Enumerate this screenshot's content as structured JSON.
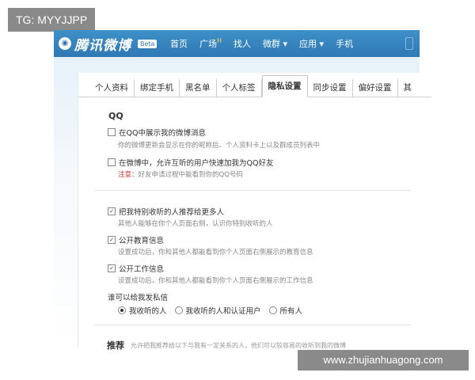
{
  "overlay_tag": "TG: MYYJJPP",
  "watermark": "www.zhujianhuagong.com",
  "header": {
    "logo_text": "腾讯微博",
    "beta": "Beta",
    "nav": [
      "首页",
      "广场",
      "找人",
      "微群 ▾",
      "应用 ▾",
      "手机"
    ],
    "hot_badge": "H"
  },
  "tabs": [
    "个人资料",
    "绑定手机",
    "黑名单",
    "个人标签",
    "隐私设置",
    "同步设置",
    "偏好设置",
    "其"
  ],
  "active_tab": "隐私设置",
  "qq_section": {
    "title": "QQ",
    "opt1_label": "在QQ中展示我的微博消息",
    "opt1_desc": "你的微博更新会显示在你的昵称后、个人资料卡上以及群成员列表中",
    "opt2_label": "在微博中，允许互听的用户快速加我为QQ好友",
    "opt2_note_label": "注意：",
    "opt2_note_text": "好友申请过程中能看到你的QQ号码"
  },
  "privacy_section": {
    "opt3_label": "把我特别收听的人推荐给更多人",
    "opt3_desc": "其他人能够在你个人页面右侧，认识你特别收听的人",
    "opt4_label": "公开教育信息",
    "opt4_desc": "设置成功后，你和其他人都能看到你个人页面右侧展示的教育信息",
    "opt5_label": "公开工作信息",
    "opt5_desc": "设置成功后，你和其他人都能看到你个人页面右侧展示的工作信息",
    "dm_title": "谁可以给我发私信",
    "dm_options": [
      "我收听的人",
      "我收听的人和认证用户",
      "所有人"
    ],
    "dm_selected": 0
  },
  "recommend": {
    "title": "推荐",
    "text": "允许把我推荐给以下与我有一定关系的人，他们可以较容易的收听到我的微博"
  },
  "colors": {
    "topbar": "#2f78b4",
    "tag_bg": "#8a8a8a",
    "note_red": "#cc3333"
  }
}
